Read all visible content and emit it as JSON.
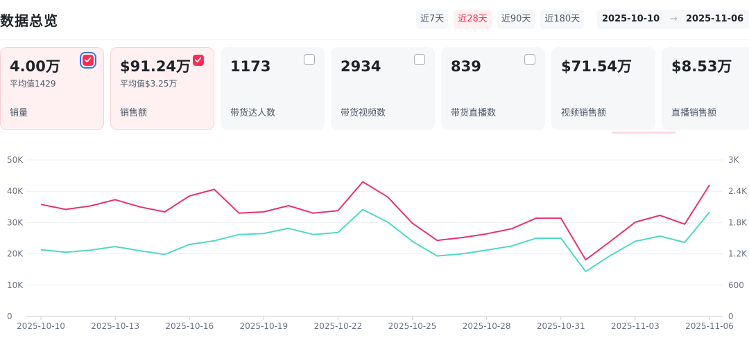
{
  "header": {
    "title": "数据总览",
    "ranges": [
      {
        "label": "近7天",
        "active": false
      },
      {
        "label": "近28天",
        "active": true
      },
      {
        "label": "近90天",
        "active": false
      },
      {
        "label": "近180天",
        "active": false
      }
    ],
    "date_start": "2025-10-10",
    "date_arrow": "→",
    "date_end": "2025-11-06"
  },
  "cards": [
    {
      "value": "4.00万",
      "avg": "平均值1429",
      "label": "销量",
      "checked": true
    },
    {
      "value": "$91.24万",
      "avg": "平均值$3.25万",
      "label": "销售额",
      "checked": true
    },
    {
      "value": "1173",
      "avg": "",
      "label": "带货达人数",
      "checked": false
    },
    {
      "value": "2934",
      "avg": "",
      "label": "带货视频数",
      "checked": false
    },
    {
      "value": "839",
      "avg": "",
      "label": "带货直播数",
      "checked": false
    },
    {
      "value": "$71.54万",
      "avg": "",
      "label": "视频销售额",
      "checked": false
    },
    {
      "value": "$8.53万",
      "avg": "",
      "label": "直播销售额",
      "checked": false
    }
  ],
  "colors": {
    "accent": "#fe2c55",
    "series_sales": "#e8336d",
    "series_volume": "#4fd8c8"
  },
  "chart_data": {
    "type": "line",
    "x": [
      "2025-10-10",
      "2025-10-11",
      "2025-10-12",
      "2025-10-13",
      "2025-10-14",
      "2025-10-15",
      "2025-10-16",
      "2025-10-17",
      "2025-10-18",
      "2025-10-19",
      "2025-10-20",
      "2025-10-21",
      "2025-10-22",
      "2025-10-23",
      "2025-10-24",
      "2025-10-25",
      "2025-10-26",
      "2025-10-27",
      "2025-10-28",
      "2025-10-29",
      "2025-10-30",
      "2025-10-31",
      "2025-11-01",
      "2025-11-02",
      "2025-11-03",
      "2025-11-04",
      "2025-11-05",
      "2025-11-06"
    ],
    "x_ticks": [
      "2025-10-10",
      "2025-10-13",
      "2025-10-16",
      "2025-10-19",
      "2025-10-22",
      "2025-10-25",
      "2025-10-28",
      "2025-10-31",
      "2025-11-03",
      "2025-11-06"
    ],
    "y_left": {
      "ticks": [
        "0",
        "10K",
        "20K",
        "30K",
        "40K",
        "50K"
      ],
      "ylim": [
        0,
        50000
      ]
    },
    "y_right": {
      "ticks": [
        "0",
        "600",
        "1.2K",
        "1.8K",
        "2.4K",
        "3K"
      ],
      "ylim": [
        0,
        3000
      ]
    },
    "series": [
      {
        "axis": "left",
        "color": "#e8336d",
        "values": [
          35800,
          34200,
          35300,
          37300,
          35000,
          33400,
          38500,
          40600,
          33000,
          33400,
          35400,
          33000,
          33800,
          43000,
          38200,
          29800,
          24300,
          25200,
          26400,
          28000,
          31400,
          31400,
          18100,
          24000,
          30100,
          32300,
          29500,
          42000
        ]
      },
      {
        "axis": "right",
        "color": "#4fd8c8",
        "values": [
          1280,
          1230,
          1270,
          1340,
          1260,
          1190,
          1380,
          1450,
          1570,
          1590,
          1690,
          1570,
          1610,
          2050,
          1810,
          1440,
          1160,
          1200,
          1270,
          1350,
          1500,
          1500,
          860,
          1170,
          1440,
          1540,
          1420,
          2000
        ]
      }
    ]
  }
}
